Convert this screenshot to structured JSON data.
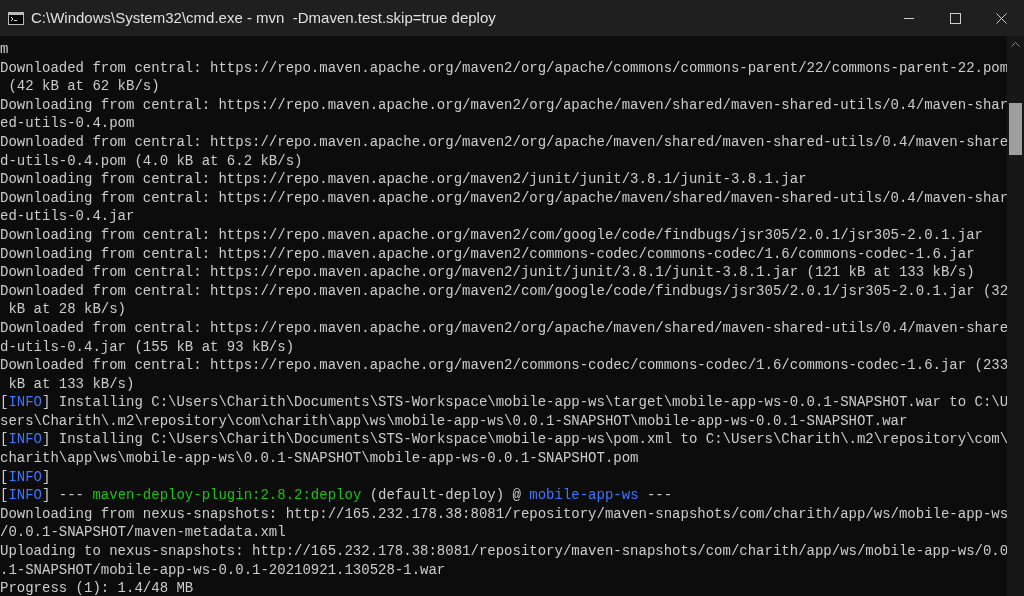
{
  "window": {
    "title": "C:\\Windows\\System32\\cmd.exe - mvn  -Dmaven.test.skip=true deploy"
  },
  "console": {
    "lines": [
      [
        {
          "text": "m"
        }
      ],
      [
        {
          "text": "Downloaded from central: https://repo.maven.apache.org/maven2/org/apache/commons/commons-parent/22/commons-parent-22.pom"
        }
      ],
      [
        {
          "text": " (42 kB at 62 kB/s)"
        }
      ],
      [
        {
          "text": "Downloading from central: https://repo.maven.apache.org/maven2/org/apache/maven/shared/maven-shared-utils/0.4/maven-shar"
        }
      ],
      [
        {
          "text": "ed-utils-0.4.pom"
        }
      ],
      [
        {
          "text": "Downloaded from central: https://repo.maven.apache.org/maven2/org/apache/maven/shared/maven-shared-utils/0.4/maven-share"
        }
      ],
      [
        {
          "text": "d-utils-0.4.pom (4.0 kB at 6.2 kB/s)"
        }
      ],
      [
        {
          "text": "Downloading from central: https://repo.maven.apache.org/maven2/junit/junit/3.8.1/junit-3.8.1.jar"
        }
      ],
      [
        {
          "text": "Downloading from central: https://repo.maven.apache.org/maven2/org/apache/maven/shared/maven-shared-utils/0.4/maven-shar"
        }
      ],
      [
        {
          "text": "ed-utils-0.4.jar"
        }
      ],
      [
        {
          "text": "Downloading from central: https://repo.maven.apache.org/maven2/com/google/code/findbugs/jsr305/2.0.1/jsr305-2.0.1.jar"
        }
      ],
      [
        {
          "text": "Downloading from central: https://repo.maven.apache.org/maven2/commons-codec/commons-codec/1.6/commons-codec-1.6.jar"
        }
      ],
      [
        {
          "text": "Downloaded from central: https://repo.maven.apache.org/maven2/junit/junit/3.8.1/junit-3.8.1.jar (121 kB at 133 kB/s)"
        }
      ],
      [
        {
          "text": "Downloaded from central: https://repo.maven.apache.org/maven2/com/google/code/findbugs/jsr305/2.0.1/jsr305-2.0.1.jar (32"
        }
      ],
      [
        {
          "text": " kB at 28 kB/s)"
        }
      ],
      [
        {
          "text": "Downloaded from central: https://repo.maven.apache.org/maven2/org/apache/maven/shared/maven-shared-utils/0.4/maven-share"
        }
      ],
      [
        {
          "text": "d-utils-0.4.jar (155 kB at 93 kB/s)"
        }
      ],
      [
        {
          "text": "Downloaded from central: https://repo.maven.apache.org/maven2/commons-codec/commons-codec/1.6/commons-codec-1.6.jar (233"
        }
      ],
      [
        {
          "text": " kB at 133 kB/s)"
        }
      ],
      [
        {
          "text": "["
        },
        {
          "text": "INFO",
          "color": "#3b78ff"
        },
        {
          "text": "] Installing C:\\Users\\Charith\\Documents\\STS-Workspace\\mobile-app-ws\\target\\mobile-app-ws-0.0.1-SNAPSHOT.war to C:\\U"
        }
      ],
      [
        {
          "text": "sers\\Charith\\.m2\\repository\\com\\charith\\app\\ws\\mobile-app-ws\\0.0.1-SNAPSHOT\\mobile-app-ws-0.0.1-SNAPSHOT.war"
        }
      ],
      [
        {
          "text": "["
        },
        {
          "text": "INFO",
          "color": "#3b78ff"
        },
        {
          "text": "] Installing C:\\Users\\Charith\\Documents\\STS-Workspace\\mobile-app-ws\\pom.xml to C:\\Users\\Charith\\.m2\\repository\\com\\"
        }
      ],
      [
        {
          "text": "charith\\app\\ws\\mobile-app-ws\\0.0.1-SNAPSHOT\\mobile-app-ws-0.0.1-SNAPSHOT.pom"
        }
      ],
      [
        {
          "text": "["
        },
        {
          "text": "INFO",
          "color": "#3b78ff"
        },
        {
          "text": "]"
        }
      ],
      [
        {
          "text": "["
        },
        {
          "text": "INFO",
          "color": "#3b78ff"
        },
        {
          "text": "] --- "
        },
        {
          "text": "maven-deploy-plugin:2.8.2:deploy",
          "color": "#16c60c"
        },
        {
          "text": " (default-deploy) @ "
        },
        {
          "text": "mobile-app-ws",
          "color": "#3b78ff"
        },
        {
          "text": " ---"
        }
      ],
      [
        {
          "text": "Downloading from nexus-snapshots: http://165.232.178.38:8081/repository/maven-snapshots/com/charith/app/ws/mobile-app-ws"
        }
      ],
      [
        {
          "text": "/0.0.1-SNAPSHOT/maven-metadata.xml"
        }
      ],
      [
        {
          "text": "Uploading to nexus-snapshots: http://165.232.178.38:8081/repository/maven-snapshots/com/charith/app/ws/mobile-app-ws/0.0"
        }
      ],
      [
        {
          "text": ".1-SNAPSHOT/mobile-app-ws-0.0.1-20210921.130528-1.war"
        }
      ],
      [
        {
          "text": "Progress (1): 1.4/48 MB"
        }
      ]
    ]
  }
}
